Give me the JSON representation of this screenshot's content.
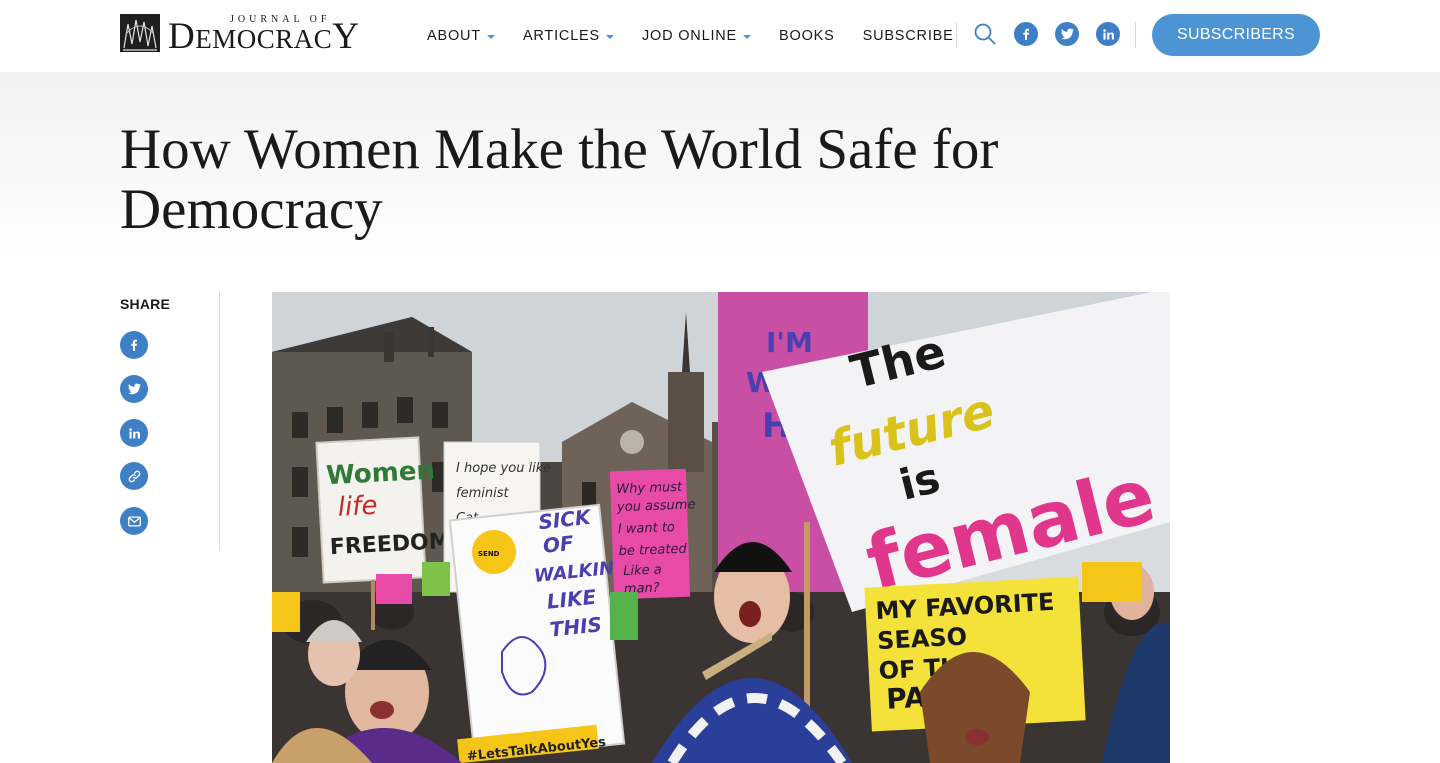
{
  "brand": {
    "logo_top": "JOURNAL OF",
    "logo_main_cap1": "D",
    "logo_main_mid": "EMOCRAC",
    "logo_main_cap2": "Y"
  },
  "nav": {
    "items": [
      {
        "label": "ABOUT",
        "has_dropdown": true
      },
      {
        "label": "ARTICLES",
        "has_dropdown": true
      },
      {
        "label": "JOD ONLINE",
        "has_dropdown": true
      },
      {
        "label": "BOOKS",
        "has_dropdown": false
      },
      {
        "label": "SUBSCRIBE",
        "has_dropdown": false
      }
    ],
    "icons": [
      "search-icon",
      "facebook-icon",
      "twitter-icon",
      "linkedin-icon"
    ],
    "subscribers_label": "SUBSCRIBERS"
  },
  "article": {
    "title": "How Women Make the World Safe for Democracy"
  },
  "share": {
    "label": "SHARE",
    "buttons": [
      "facebook-icon",
      "twitter-icon",
      "linkedin-icon",
      "link-icon",
      "email-icon"
    ]
  },
  "hero": {
    "signs": {
      "women_life_freedom": [
        "Women",
        "life",
        "FREEDOM"
      ],
      "hope_you_like": [
        "I hope you like",
        "feminist",
        "Cat"
      ],
      "sick_of_walking": [
        "SICK",
        "OF",
        "WALKING",
        "LIKE",
        "THIS"
      ],
      "why_must": [
        "Why must",
        "you assume",
        "I want to",
        "be treated",
        "Like a",
        "man?"
      ],
      "future_female": [
        "The",
        "future",
        "is",
        "female"
      ],
      "favorite_season": [
        "MY FAVORITE",
        "SEASO",
        "OF TH",
        "PAT"
      ],
      "lets_talk": "#LetsTalkAboutYes",
      "badge": "SEND",
      "im": "I'M",
      "w": "W",
      "h": "H"
    }
  },
  "colors": {
    "accent": "#3f7fc6",
    "button": "#4d94d4",
    "caret": "#4a90d9",
    "text": "#1a1a1a"
  }
}
